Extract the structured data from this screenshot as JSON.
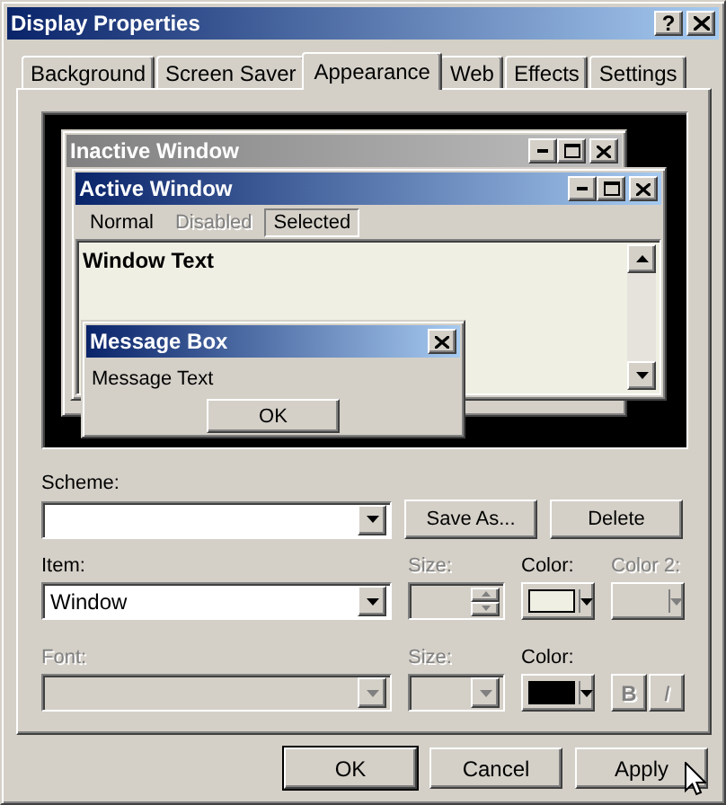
{
  "window": {
    "title": "Display Properties",
    "help_button": "?"
  },
  "tabs": [
    {
      "label": "Background",
      "selected": false
    },
    {
      "label": "Screen Saver",
      "selected": false
    },
    {
      "label": "Appearance",
      "selected": true
    },
    {
      "label": "Web",
      "selected": false
    },
    {
      "label": "Effects",
      "selected": false
    },
    {
      "label": "Settings",
      "selected": false
    }
  ],
  "preview": {
    "inactive_window": {
      "title": "Inactive Window"
    },
    "active_window": {
      "title": "Active Window",
      "menu": [
        {
          "label": "Normal",
          "disabled": false,
          "selected": false
        },
        {
          "label": "Disabled",
          "disabled": true,
          "selected": false
        },
        {
          "label": "Selected",
          "disabled": false,
          "selected": true
        }
      ],
      "window_text": "Window Text"
    },
    "message_box": {
      "title": "Message Box",
      "message": "Message Text",
      "button": "OK"
    }
  },
  "scheme": {
    "label": "Scheme:",
    "buttons": [
      "Save As...",
      "Delete"
    ]
  },
  "item_row": {
    "item": {
      "label": "Item:",
      "value": "Window",
      "disabled": false
    },
    "size": {
      "label": "Size:",
      "disabled": true
    },
    "color": {
      "label": "Color:",
      "disabled": false,
      "color": "#f0efe4"
    },
    "color2": {
      "label": "Color 2:",
      "disabled": true
    }
  },
  "font_row": {
    "font": {
      "label": "Font:",
      "disabled": true
    },
    "size": {
      "label": "Size:",
      "disabled": true
    },
    "color": {
      "label": "Color:",
      "disabled": false,
      "color": "#000000"
    },
    "bold": {
      "label": "B",
      "disabled": true
    },
    "italic": {
      "label": "I",
      "disabled": true
    }
  },
  "buttons": [
    {
      "label": "OK",
      "default": true
    },
    {
      "label": "Cancel",
      "default": false
    },
    {
      "label": "Apply",
      "default": false
    }
  ]
}
